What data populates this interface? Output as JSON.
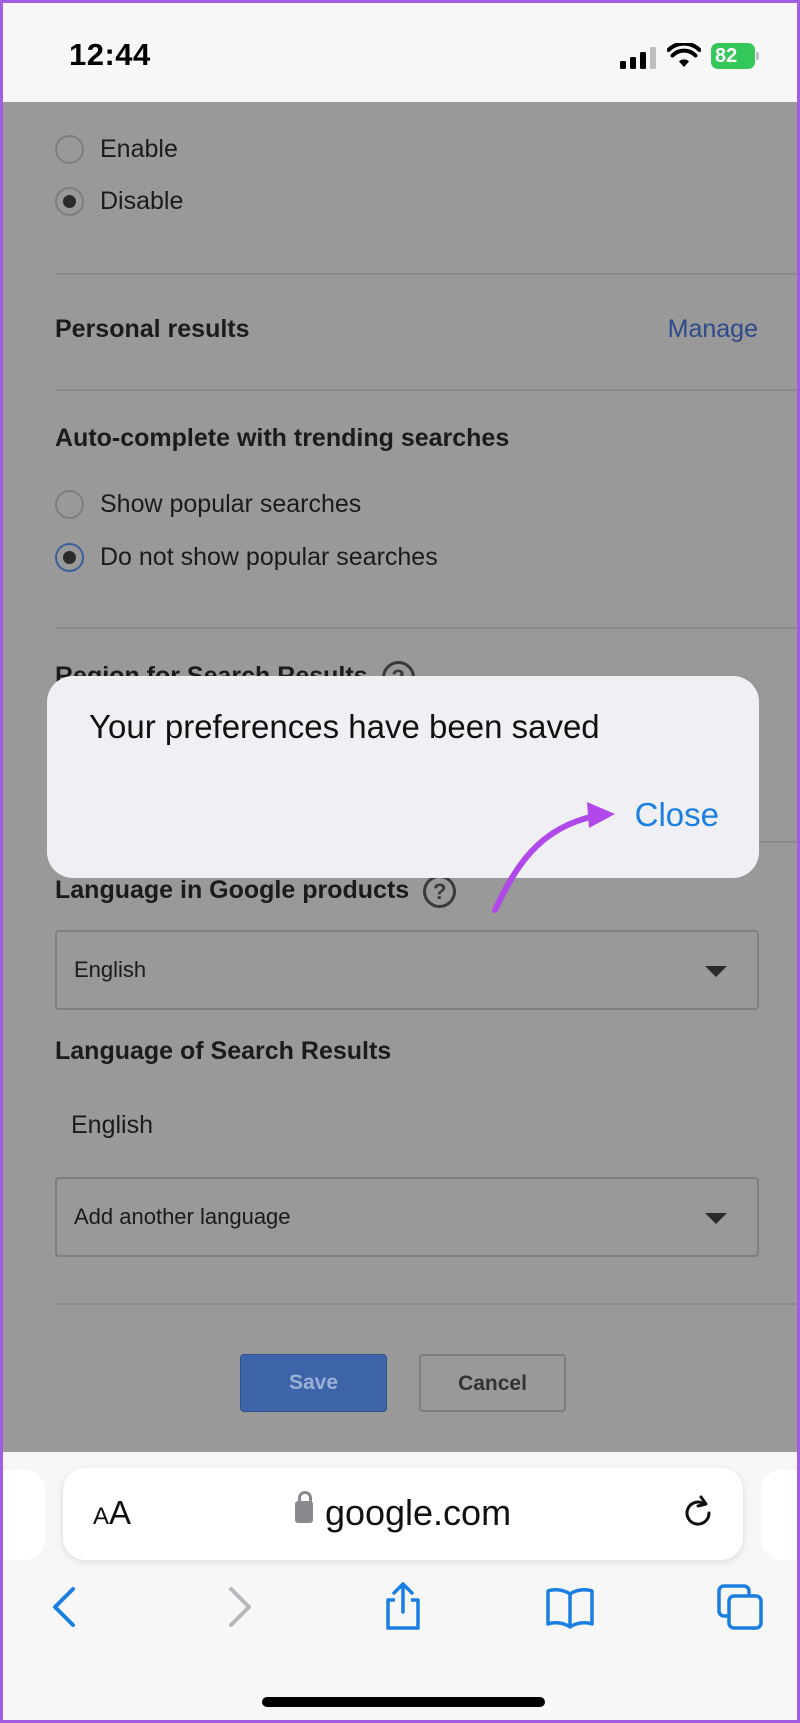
{
  "status_bar": {
    "time": "12:44",
    "battery": "82"
  },
  "page": {
    "radio_group_1": [
      {
        "label": "Enable",
        "checked": false
      },
      {
        "label": "Disable",
        "checked": true
      }
    ],
    "personal_results": {
      "title": "Personal results",
      "link": "Manage"
    },
    "autocomplete": {
      "title": "Auto-complete with trending searches",
      "options": [
        {
          "label": "Show popular searches",
          "checked": false
        },
        {
          "label": "Do not show popular searches",
          "checked": true
        }
      ]
    },
    "region_title": "Region for Search Results",
    "language_products": {
      "title": "Language in Google products",
      "value": "English"
    },
    "language_results": {
      "title": "Language of Search Results",
      "current": "English",
      "add_placeholder": "Add another language"
    },
    "buttons": {
      "save": "Save",
      "cancel": "Cancel"
    }
  },
  "dialog": {
    "message": "Your preferences have been saved",
    "close": "Close"
  },
  "browser": {
    "aa_label_small": "A",
    "aa_label_big": "A",
    "url": "google.com"
  },
  "colors": {
    "accent": "#1a7fe0",
    "annotation_arrow": "#b048ea",
    "battery": "#34c759"
  }
}
